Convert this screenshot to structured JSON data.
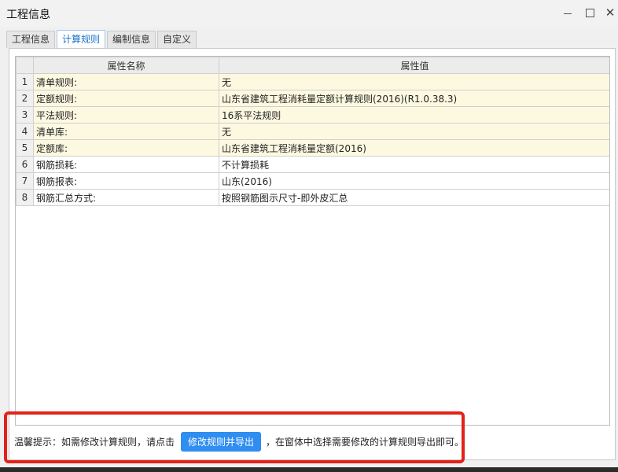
{
  "window": {
    "title": "工程信息",
    "minimize_label": "",
    "maximize_label": "",
    "close_label": "✕"
  },
  "tabs": [
    {
      "label": "工程信息",
      "active": false
    },
    {
      "label": "计算规则",
      "active": true
    },
    {
      "label": "编制信息",
      "active": false
    },
    {
      "label": "自定义",
      "active": false
    }
  ],
  "table": {
    "headers": [
      "",
      "属性名称",
      "属性值"
    ],
    "rows": [
      {
        "index": "1",
        "name": "清单规则:",
        "value": "无",
        "highlight": true
      },
      {
        "index": "2",
        "name": "定额规则:",
        "value": "山东省建筑工程消耗量定额计算规则(2016)(R1.0.38.3)",
        "highlight": true
      },
      {
        "index": "3",
        "name": "平法规则:",
        "value": "16系平法规则",
        "highlight": true
      },
      {
        "index": "4",
        "name": "清单库:",
        "value": "无",
        "highlight": true
      },
      {
        "index": "5",
        "name": "定额库:",
        "value": "山东省建筑工程消耗量定额(2016)",
        "highlight": true
      },
      {
        "index": "6",
        "name": "钢筋损耗:",
        "value": "不计算损耗",
        "highlight": false
      },
      {
        "index": "7",
        "name": "钢筋报表:",
        "value": "山东(2016)",
        "highlight": false
      },
      {
        "index": "8",
        "name": "钢筋汇总方式:",
        "value": "按照钢筋图示尺寸-即外皮汇总",
        "highlight": false
      }
    ]
  },
  "hint": {
    "prefix": "温馨提示：如需修改计算规则，请点击",
    "button_label": "修改规则并导出",
    "suffix": "，在窗体中选择需要修改的计算规则导出即可。"
  },
  "colors": {
    "accent": "#2f8ef0",
    "highlight_row": "#fdf9e1",
    "callout_border": "#e2231a"
  }
}
